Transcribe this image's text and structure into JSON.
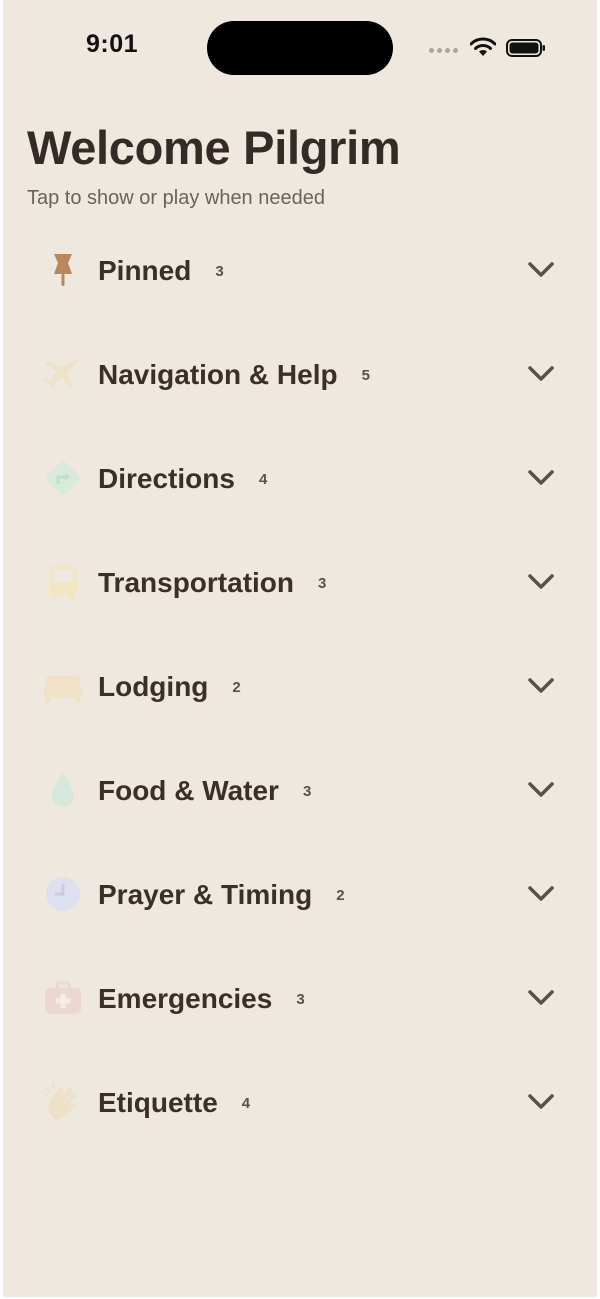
{
  "status_bar": {
    "time": "9:01"
  },
  "header": {
    "title": "Welcome Pilgrim",
    "subtitle": "Tap to show or play when needed"
  },
  "categories": [
    {
      "label": "Pinned",
      "count": "3",
      "icon": "pushpin-icon",
      "icon_color": "#b8875a"
    },
    {
      "label": "Navigation & Help",
      "count": "5",
      "icon": "airplane-icon",
      "icon_color": "#ede3c8"
    },
    {
      "label": "Directions",
      "count": "4",
      "icon": "direction-sign-icon",
      "icon_color": "#d8eadc"
    },
    {
      "label": "Transportation",
      "count": "3",
      "icon": "bus-icon",
      "icon_color": "#f1e6c4"
    },
    {
      "label": "Lodging",
      "count": "2",
      "icon": "bed-icon",
      "icon_color": "#f1e1c7"
    },
    {
      "label": "Food & Water",
      "count": "3",
      "icon": "droplet-icon",
      "icon_color": "#d6e8dc"
    },
    {
      "label": "Prayer & Timing",
      "count": "2",
      "icon": "clock-icon",
      "icon_color": "#dde0ee"
    },
    {
      "label": "Emergencies",
      "count": "3",
      "icon": "first-aid-kit-icon",
      "icon_color": "#ecd7d3"
    },
    {
      "label": "Etiquette",
      "count": "4",
      "icon": "clapping-hands-icon",
      "icon_color": "#eee0c9"
    }
  ],
  "colors": {
    "background": "#efe8df",
    "text_primary": "#3a2f2b",
    "text_secondary": "#6b625d",
    "chevron": "#5a4f4a"
  }
}
